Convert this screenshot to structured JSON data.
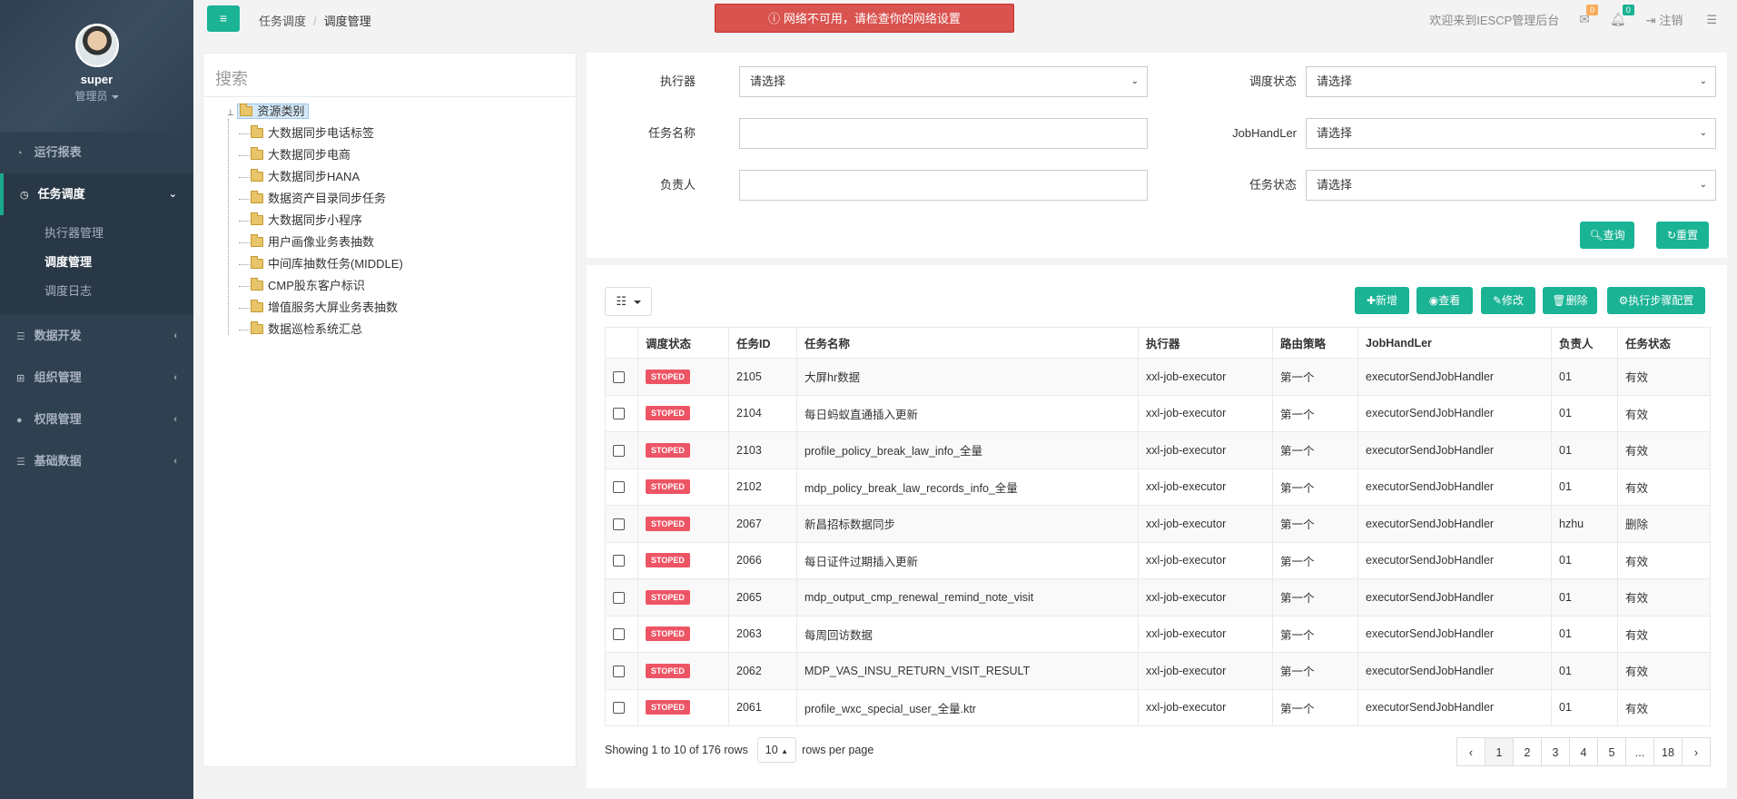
{
  "sidebar": {
    "username": "super",
    "role": "管理员",
    "items": [
      {
        "label": "运行报表",
        "icon": "dashboard-icon"
      },
      {
        "label": "任务调度",
        "icon": "clock-icon"
      },
      {
        "label": "数据开发",
        "icon": "database-icon"
      },
      {
        "label": "组织管理",
        "icon": "sitemap-icon"
      },
      {
        "label": "权限管理",
        "icon": "user-icon"
      },
      {
        "label": "基础数据",
        "icon": "database-icon"
      }
    ],
    "subitems": [
      "执行器管理",
      "调度管理",
      "调度日志"
    ]
  },
  "header": {
    "breadcrumb_parent": "任务调度",
    "breadcrumb_current": "调度管理",
    "alert": "网络不可用，请检查你的网络设置",
    "welcome": "欢迎来到IESCP管理后台",
    "mail_count": "0",
    "bell_count": "0",
    "logout": "注销"
  },
  "tree": {
    "search_placeholder": "搜索",
    "root": "资源类别",
    "nodes": [
      "大数据同步电话标签",
      "大数据同步电商",
      "大数据同步HANA",
      "数据资产目录同步任务",
      "大数据同步小程序",
      "用户画像业务表抽数",
      "中间库抽数任务(MIDDLE)",
      "CMP股东客户标识",
      "增值服务大屏业务表抽数",
      "数据巡检系统汇总"
    ]
  },
  "form": {
    "executor_label": "执行器",
    "executor_value": "请选择",
    "schedule_status_label": "调度状态",
    "schedule_status_value": "请选择",
    "task_name_label": "任务名称",
    "jobhandler_label": "JobHandLer",
    "jobhandler_value": "请选择",
    "owner_label": "负责人",
    "task_status_label": "任务状态",
    "task_status_value": "请选择",
    "query_btn": "查询",
    "reset_btn": "重置"
  },
  "toolbar": {
    "add": "新增",
    "view": "查看",
    "edit": "修改",
    "delete": "删除",
    "steps": "执行步骤配置"
  },
  "table": {
    "columns": [
      "调度状态",
      "任务ID",
      "任务名称",
      "执行器",
      "路由策略",
      "JobHandLer",
      "负责人",
      "任务状态"
    ],
    "rows": [
      {
        "status": "STOPED",
        "id": "2105",
        "name": "大屏hr数据",
        "executor": "xxl-job-executor",
        "route": "第一个",
        "handler": "executorSendJobHandler",
        "owner": "01",
        "task_status": "有效"
      },
      {
        "status": "STOPED",
        "id": "2104",
        "name": "每日蚂蚁直通插入更新",
        "executor": "xxl-job-executor",
        "route": "第一个",
        "handler": "executorSendJobHandler",
        "owner": "01",
        "task_status": "有效"
      },
      {
        "status": "STOPED",
        "id": "2103",
        "name": "profile_policy_break_law_info_全量",
        "executor": "xxl-job-executor",
        "route": "第一个",
        "handler": "executorSendJobHandler",
        "owner": "01",
        "task_status": "有效"
      },
      {
        "status": "STOPED",
        "id": "2102",
        "name": "mdp_policy_break_law_records_info_全量",
        "executor": "xxl-job-executor",
        "route": "第一个",
        "handler": "executorSendJobHandler",
        "owner": "01",
        "task_status": "有效"
      },
      {
        "status": "STOPED",
        "id": "2067",
        "name": "新昌招标数据同步",
        "executor": "xxl-job-executor",
        "route": "第一个",
        "handler": "executorSendJobHandler",
        "owner": "hzhu",
        "task_status": "删除"
      },
      {
        "status": "STOPED",
        "id": "2066",
        "name": "每日证件过期插入更新",
        "executor": "xxl-job-executor",
        "route": "第一个",
        "handler": "executorSendJobHandler",
        "owner": "01",
        "task_status": "有效"
      },
      {
        "status": "STOPED",
        "id": "2065",
        "name": "mdp_output_cmp_renewal_remind_note_visit",
        "executor": "xxl-job-executor",
        "route": "第一个",
        "handler": "executorSendJobHandler",
        "owner": "01",
        "task_status": "有效"
      },
      {
        "status": "STOPED",
        "id": "2063",
        "name": "每周回访数据",
        "executor": "xxl-job-executor",
        "route": "第一个",
        "handler": "executorSendJobHandler",
        "owner": "01",
        "task_status": "有效"
      },
      {
        "status": "STOPED",
        "id": "2062",
        "name": "MDP_VAS_INSU_RETURN_VISIT_RESULT",
        "executor": "xxl-job-executor",
        "route": "第一个",
        "handler": "executorSendJobHandler",
        "owner": "01",
        "task_status": "有效"
      },
      {
        "status": "STOPED",
        "id": "2061",
        "name": "profile_wxc_special_user_全量.ktr",
        "executor": "xxl-job-executor",
        "route": "第一个",
        "handler": "executorSendJobHandler",
        "owner": "01",
        "task_status": "有效"
      }
    ]
  },
  "pagination": {
    "showing": "Showing 1 to 10 of 176 rows",
    "page_size": "10",
    "per_page": "rows per page",
    "prev": "‹",
    "pages": [
      "1",
      "2",
      "3",
      "4",
      "5",
      "...",
      "18"
    ],
    "next": "›"
  }
}
